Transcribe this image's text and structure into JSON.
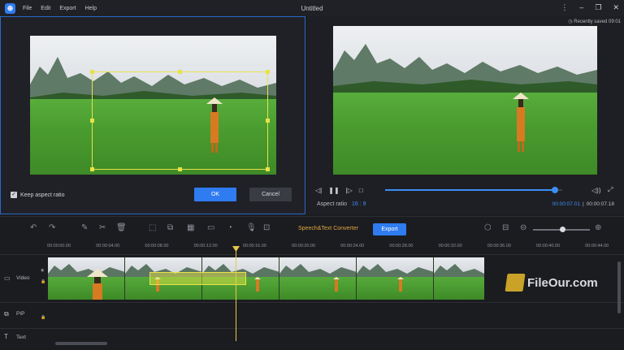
{
  "titlebar": {
    "app_logo": "filmora-logo",
    "menu": [
      "File",
      "Edit",
      "Export",
      "Help"
    ],
    "title": "Untitled",
    "controls": [
      "more-icon",
      "minimize-icon",
      "maximize-icon",
      "close-icon"
    ]
  },
  "crop_dialog": {
    "keep_aspect_label": "Keep aspect ratio",
    "keep_aspect_checked": true,
    "ok_label": "OK",
    "cancel_label": "Cancel"
  },
  "preview": {
    "saved_status": "Recently saved 09:01",
    "aspect_label": "Aspect ratio",
    "aspect_value": "16 : 9",
    "current_time": "00:00:07.01",
    "total_time": "00:00:07.18",
    "progress_fraction": 0.96
  },
  "toolbar": {
    "speech_label": "Speech&Text Converter",
    "export_label": "Export",
    "zoom_fraction": 0.52
  },
  "ruler": {
    "ticks": [
      "00:00:00.00",
      "00:00:04.00",
      "00:00:08.00",
      "00:00:12.00",
      "00:00:16.00",
      "00:00:20.00",
      "00:00:24.00",
      "00:00:28.00",
      "00:00:32.00",
      "00:00:36.00",
      "00:00:40.00",
      "00:00:44.00"
    ]
  },
  "tracks": {
    "video": "Video",
    "pip": "PIP",
    "text": "Text"
  },
  "watermark": "FileOur.com"
}
